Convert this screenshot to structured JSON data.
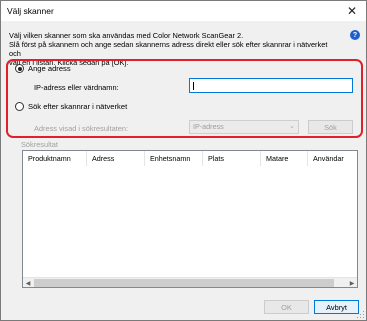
{
  "window": {
    "title": "Välj skanner",
    "close_glyph": "✕"
  },
  "instructions": {
    "lines": [
      "Välj vilken skanner som ska användas med Color Network ScanGear 2.",
      "Slå först på skannern och ange sedan skannerns adress direkt eller sök efter skannrar i nätverket och",
      "välj en i listan. Klicka sedan på [OK]."
    ]
  },
  "help_icon": "question-icon",
  "address_option": {
    "label": "Ange adress",
    "checked": true,
    "field_label": "IP-adress eller värdnamn:",
    "field_value": ""
  },
  "search_option": {
    "label": "Sök efter skannrar i nätverket",
    "checked": false,
    "display_label": "Adress visad i sökresultaten:",
    "display_value": "IP-adress",
    "search_button": "Sök"
  },
  "results": {
    "group_title": "Sökresultat",
    "columns": [
      "Produktnamn",
      "Adress",
      "Enhetsnamn",
      "Plats",
      "Matare",
      "Användar"
    ],
    "rows": []
  },
  "buttons": {
    "ok": "OK",
    "cancel": "Avbryt"
  },
  "colors": {
    "highlight": "#e0202b",
    "focus": "#0078d7",
    "help": "#1e5fd0"
  }
}
